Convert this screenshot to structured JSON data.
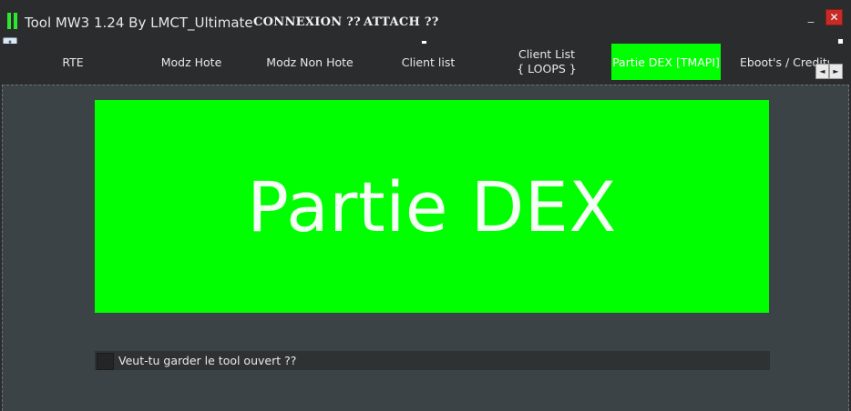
{
  "window": {
    "title": "Tool MW3 1.24 By LMCT_Ultimate",
    "menu": [
      "CONNEXION ??",
      "ATTACH ??"
    ],
    "minimize_glyph": "_",
    "close_glyph": "✕"
  },
  "tabs": [
    {
      "line1": "RTE",
      "line2": ""
    },
    {
      "line1": "Modz Hote",
      "line2": ""
    },
    {
      "line1": "Modz Non Hote",
      "line2": ""
    },
    {
      "line1": "Client list",
      "line2": ""
    },
    {
      "line1": "Client List",
      "line2": "{ LOOPS }"
    },
    {
      "line1": "Partie DEX [TMAPI]",
      "line2": ""
    },
    {
      "line1": "Eboot's / Credits",
      "line2": ""
    }
  ],
  "active_tab": "Partie DEX [TMAPI]",
  "tab_scroll": {
    "left": "◄",
    "right": "►"
  },
  "content": {
    "banner_text": "Partie DEX",
    "checkbox_label": "Veut-tu garder le tool ouvert ??",
    "checkbox_checked": false
  },
  "colors": {
    "accent": "#00ff00",
    "background": "#2b2c2e",
    "panel": "#3c4347",
    "close": "#c62b26"
  }
}
